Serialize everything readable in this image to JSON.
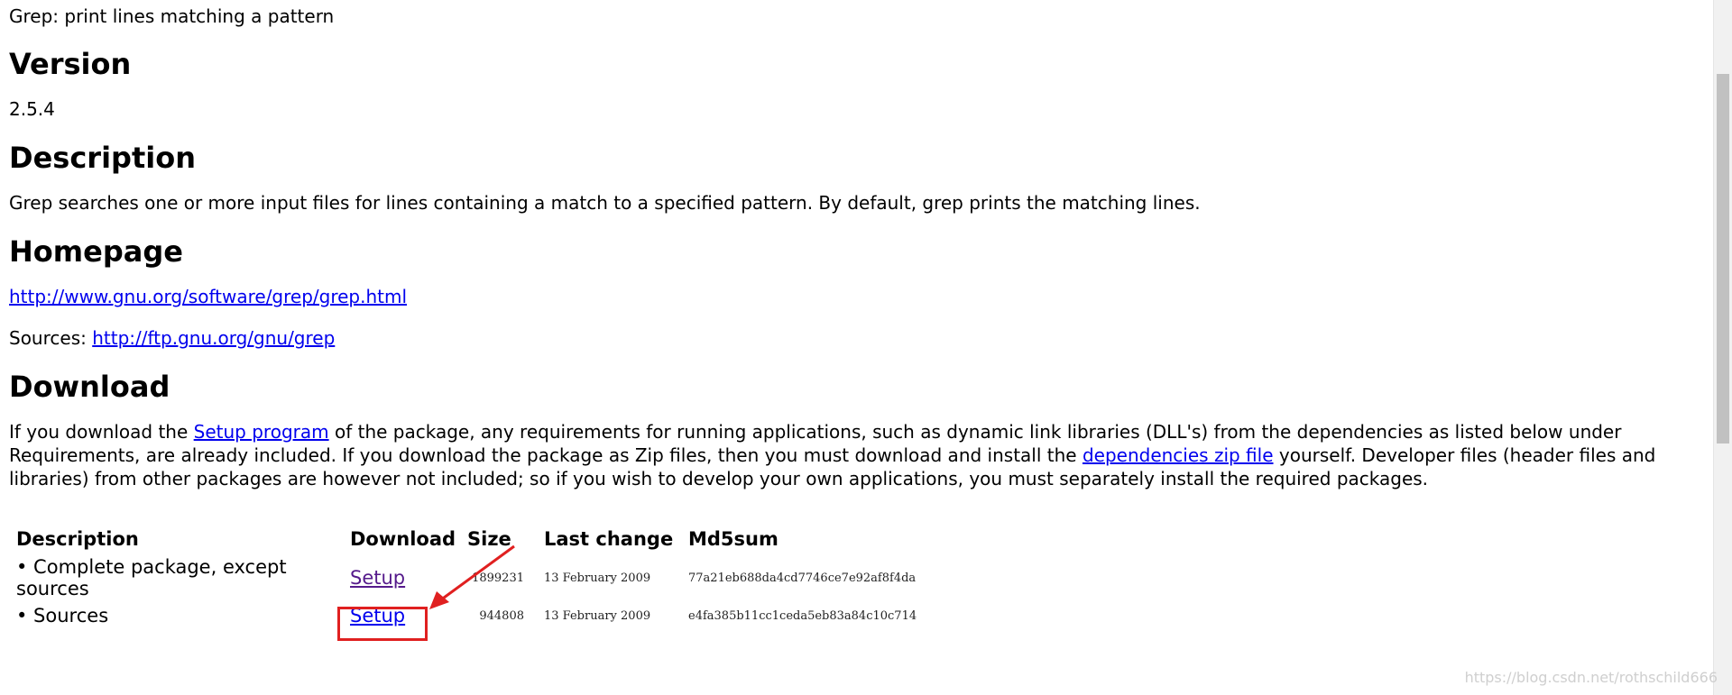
{
  "page": {
    "top_line": "Grep: print lines matching a pattern",
    "sections": {
      "version_heading": "Version",
      "version_value": "2.5.4",
      "description_heading": "Description",
      "description_text": "Grep searches one or more input files for lines containing a match to a specified pattern. By default, grep prints the matching lines.",
      "homepage_heading": "Homepage",
      "homepage_url": "http://www.gnu.org/software/grep/grep.html",
      "sources_label": "Sources:",
      "sources_url": "http://ftp.gnu.org/gnu/grep",
      "download_heading": "Download"
    },
    "download_text": {
      "part1": "If you download the ",
      "setup_link": "Setup program",
      "part2": " of the package, any requirements for running applications, such as dynamic link libraries (DLL's) from the dependencies as listed below under Requirements, are already included. If you download the package as Zip files, then you must download and install the ",
      "deps_link": "dependencies zip file",
      "part3": " yourself. Developer files (header files and libraries) from other packages are however not included; so if you wish to develop your own applications, you must separately install the required packages."
    }
  },
  "table": {
    "headers": [
      "Description",
      "Download",
      "Size",
      "Last change",
      "Md5sum"
    ],
    "rows": [
      {
        "description": "• Complete package, except sources",
        "download": "Setup",
        "size": "1899231",
        "last_change": "13 February 2009",
        "md5": "77a21eb688da4cd7746ce7e92af8f4da"
      },
      {
        "description": "• Sources",
        "download": "Setup",
        "size": "944808",
        "last_change": "13 February 2009",
        "md5": "e4fa385b11cc1ceda5eb83a84c10c714"
      }
    ]
  },
  "annotation": {
    "color": "#e02020"
  },
  "watermark": "https://blog.csdn.net/rothschild666"
}
